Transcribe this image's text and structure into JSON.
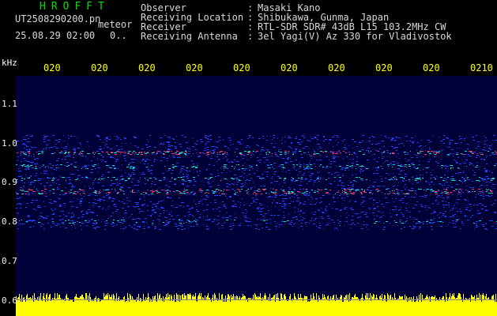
{
  "header": {
    "app_title": "HROFFT",
    "file_name": "UT2508290200.pn",
    "file_ext": "meteor",
    "timestamp": "25.08.29 02:00",
    "count": "0.."
  },
  "info": {
    "labels": [
      "Observer",
      "Receiving Location",
      "Receiver",
      "Receiving Antenna"
    ],
    "colons": [
      ":",
      ":",
      ":",
      ":"
    ],
    "values": [
      "Masaki Kano",
      "Shibukawa, Gunma, Japan",
      "RTL-SDR SDR# 43dB L15 103.2MHz CW",
      "3el Yagi(V) Az 330 for Vladivostok"
    ]
  },
  "axis": {
    "unit": "kHz",
    "y_ticks": [
      "1.1",
      "1.0",
      "0.9",
      "0.8",
      "0.7",
      "0.6"
    ],
    "x_ticks": [
      "020",
      "020",
      "020",
      "020",
      "020",
      "020",
      "020",
      "020",
      "020",
      "0210"
    ]
  },
  "colors": {
    "background": "#000000",
    "plot_background": "#000038",
    "title": "#00e000",
    "tick_x": "#ffff00",
    "histogram": "#ffff00",
    "strong_signal": "#ff3070",
    "medium_signal": "#00e0c0",
    "weak_signal": "#2040ff"
  }
}
